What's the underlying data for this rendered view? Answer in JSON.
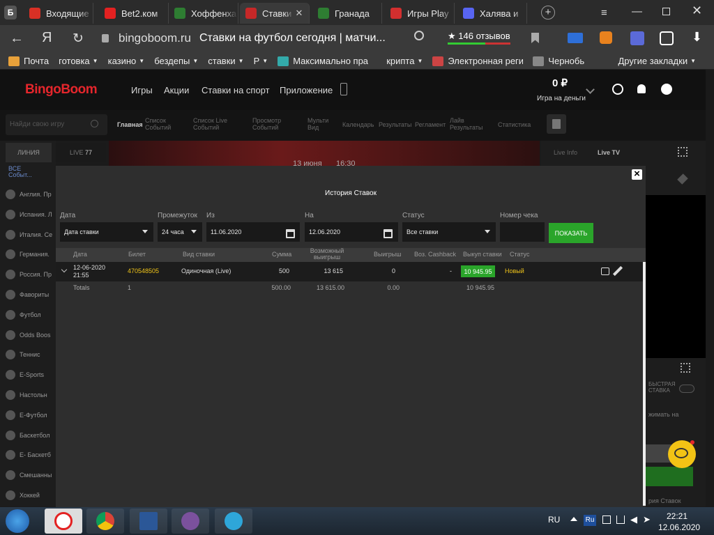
{
  "browser": {
    "tabs": [
      {
        "label": "Входящие",
        "icon": "gmail-icon",
        "color": "#d93025"
      },
      {
        "label": "Bet2.ком",
        "icon": "yandex-icon",
        "color": "#e32121"
      },
      {
        "label": "Хоффенха",
        "icon": "soccer-icon",
        "color": "#2e7d32"
      },
      {
        "label": "Ставки",
        "icon": "bingoboom-icon",
        "color": "#c62828"
      },
      {
        "label": "Гранада",
        "icon": "soccer-icon",
        "color": "#2e7d32"
      },
      {
        "label": "Игры Play",
        "icon": "star-icon",
        "color": "#d32f2f"
      },
      {
        "label": "Халява и",
        "icon": "discord-icon",
        "color": "#5865f2"
      }
    ],
    "url": "bingoboom.ru",
    "page_title": "Ставки на футбол сегодня | матчи...",
    "reviews": "★ 146 отзывов",
    "bookmarks": [
      "Почта",
      "готовка",
      "казино",
      "бездепы",
      "ставки",
      "Р",
      "Максимально пра",
      "крипта",
      "Электронная реги",
      "Чернобь",
      "Другие закладки"
    ]
  },
  "site": {
    "logo": "BingoBoom",
    "nav": [
      "Игры",
      "Акции",
      "Ставки на спорт",
      "Приложение"
    ],
    "balance": "0 ₽",
    "balance_caption": "Игра на деньги",
    "search_placeholder": "Найди свою игру",
    "subnav": [
      "Главная",
      "Список Событий",
      "Список Live Событий",
      "Просмотр Событий",
      "Мульти Вид",
      "Календарь",
      "Результаты",
      "Регламент",
      "Лайв Результаты",
      "Статистика"
    ],
    "left_tabs": {
      "line": "ЛИНИЯ",
      "live": "LIVE",
      "live_count": "77"
    },
    "left_all": "ВСЕ Событ...",
    "left_items": [
      "Англия. Пр",
      "Испания. Л",
      "Италия. Се",
      "Германия.",
      "Россия. Пр",
      "Фавориты",
      "Футбол",
      "Odds Boos",
      "Теннис",
      "E-Sports",
      "Настольн",
      "E-Футбол",
      "Баскетбол",
      "E- Баскетб",
      "Смешанны",
      "Хоккей"
    ],
    "match_date": "13 июня",
    "match_time": "16:30",
    "right_tabs": [
      "Live Info",
      "Live TV"
    ],
    "fast_bet": "БЫСТРАЯ СТАВКА",
    "right_text": "жимать на",
    "right_history": "рия Ставок"
  },
  "modal": {
    "title": "История Ставок",
    "close": "×",
    "filters": {
      "date_label": "Дата",
      "date_value": "Дата ставки",
      "period_label": "Промежуток",
      "period_value": "24 часа",
      "from_label": "Из",
      "from_value": "11.06.2020",
      "to_label": "На",
      "to_value": "12.06.2020",
      "status_label": "Статус",
      "status_value": "Все ставки",
      "check_label": "Номер чека",
      "check_value": "",
      "show_button": "ПОКАЗАТЬ"
    },
    "columns": [
      "Дата",
      "Билет",
      "Вид ставки",
      "Сумма",
      "Возможный выигрыш",
      "Выигрыш",
      "Воз. Cashback",
      "Выкуп ставки",
      "Статус"
    ],
    "row": {
      "date": "12-06-2020",
      "time": "21:55",
      "ticket": "470548505",
      "type": "Одиночная (Live)",
      "amount": "500",
      "possible": "13 615",
      "win": "0",
      "cashback": "-",
      "buyout": "10 945.95",
      "status": "Новый"
    },
    "totals": {
      "label": "Totals",
      "count": "1",
      "amount": "500.00",
      "possible": "13 615.00",
      "win": "0.00",
      "buyout": "10 945.95"
    }
  },
  "taskbar": {
    "lang": "RU",
    "lang_badge": "Ru",
    "time": "22:21",
    "date": "12.06.2020"
  },
  "colors": {
    "accent_red": "#e5262c",
    "green": "#2aa52a",
    "ticket": "#f0c419"
  }
}
